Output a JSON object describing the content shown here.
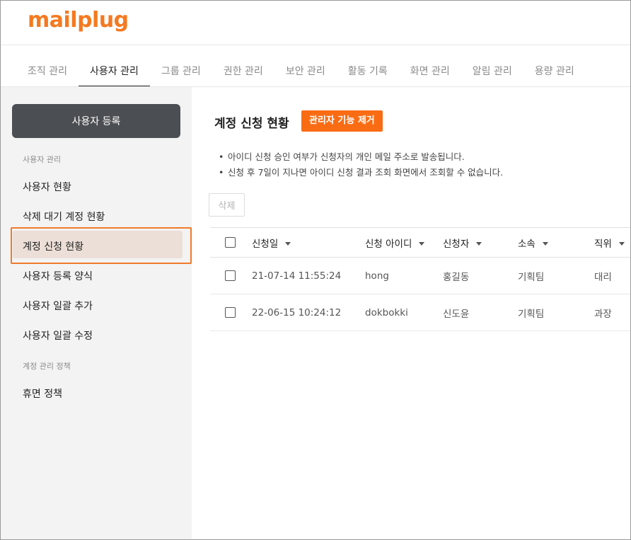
{
  "logo": {
    "text": "mailplug"
  },
  "tabs": [
    {
      "label": "조직 관리"
    },
    {
      "label": "사용자 관리"
    },
    {
      "label": "그룹 관리"
    },
    {
      "label": "권한 관리"
    },
    {
      "label": "보안 관리"
    },
    {
      "label": "활동 기록"
    },
    {
      "label": "화면 관리"
    },
    {
      "label": "알림 관리"
    },
    {
      "label": "용량 관리"
    }
  ],
  "active_tab": "사용자 관리",
  "sidebar": {
    "register_button": "사용자 등록",
    "section1_heading": "사용자 관리",
    "items": [
      {
        "label": "사용자 현황"
      },
      {
        "label": "삭제 대기 계정 현황"
      },
      {
        "label": "계정 신청 현황"
      },
      {
        "label": "사용자 등록 양식"
      },
      {
        "label": "사용자 일괄 추가"
      },
      {
        "label": "사용자 일괄 수정"
      }
    ],
    "section2_heading": "계정 관리 정책",
    "section2_items": [
      {
        "label": "휴면 정책"
      }
    ],
    "active_item": "계정 신청 현황"
  },
  "main": {
    "title": "계정 신청 현황",
    "admin_button": "관리자 기능 제거",
    "notes": [
      "아이디 신청 승인 여부가 신청자의 개인 메일 주소로 발송됩니다.",
      "신청 후 7일이 지나면 아이디 신청 결과 조회 화면에서 조회할 수 없습니다."
    ],
    "delete_button": "삭제",
    "table": {
      "headers": [
        "신청일",
        "신청 아이디",
        "신청자",
        "소속",
        "직위"
      ],
      "rows": [
        {
          "date": "21-07-14 11:55:24",
          "id": "hong",
          "name": "홍길동",
          "dept": "기획팀",
          "position": "대리"
        },
        {
          "date": "22-06-15 10:24:12",
          "id": "dokbokki",
          "name": "신도윤",
          "dept": "기획팀",
          "position": "과장"
        }
      ]
    }
  },
  "colors": {
    "brand": "#f47a20",
    "admin_button": "#fa6c14",
    "register_button": "#4b4e52",
    "highlight_outline": "#f07a2a",
    "highlight_fill": "#ecdfd7",
    "sidebar_bg": "#f3f3f3"
  }
}
